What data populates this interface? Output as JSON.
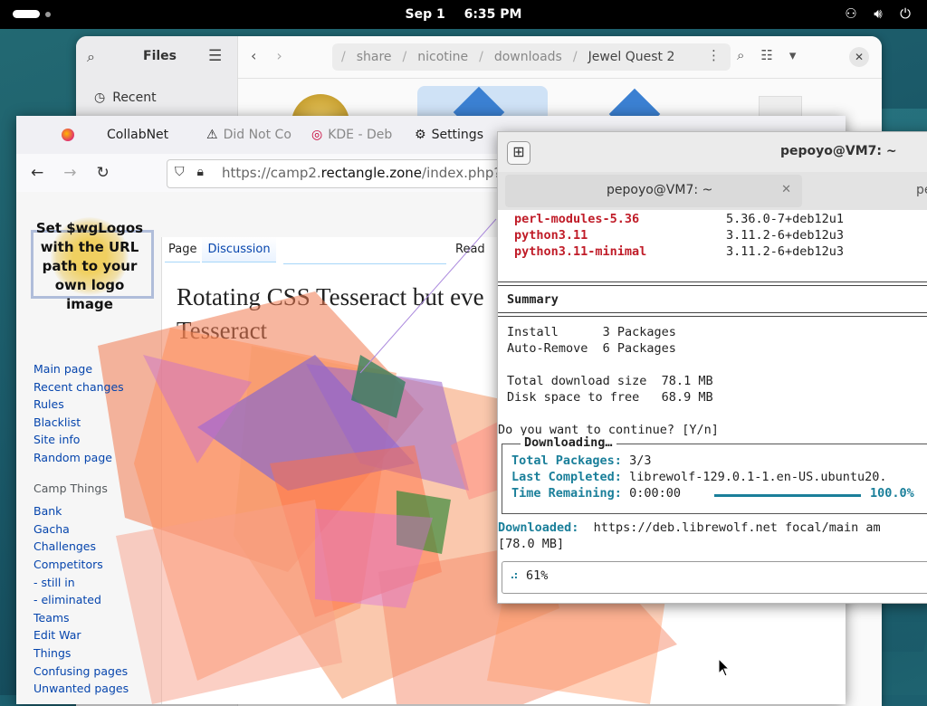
{
  "topbar": {
    "date": "Sep 1",
    "time": "6:35 PM",
    "tray_icons": [
      "network-icon",
      "volume-icon",
      "power-icon"
    ]
  },
  "files": {
    "title": "Files",
    "sidebar_recent": "Recent",
    "breadcrumbs": [
      "share",
      "nicotine",
      "downloads",
      "Jewel Quest 2"
    ]
  },
  "browser": {
    "tabs": [
      {
        "label": "CollabNet"
      },
      {
        "label": "Did Not Co"
      },
      {
        "label": "KDE - Deb"
      },
      {
        "label": "Settings"
      }
    ],
    "url_prefix": "https://camp2.",
    "url_domain": "rectangle.zone",
    "url_suffix": "/index.php?title",
    "logo_text": "Set $wgLogos with the URL path to your own logo image",
    "content_tabs": {
      "page": "Page",
      "discussion": "Discussion",
      "read": "Read"
    },
    "page_title": "Rotating CSS Tesseract but eve Tesseract",
    "nav_main": [
      "Main page",
      "Recent changes",
      "Rules",
      "Blacklist",
      "Site info",
      "Random page"
    ],
    "nav_section_title": "Camp Things",
    "nav_camp": [
      "Bank",
      "Gacha",
      "Challenges",
      "Competitors",
      "- still in",
      "- eliminated",
      "Teams",
      "Edit War",
      "Things",
      "Confusing pages",
      "Unwanted pages"
    ]
  },
  "terminal": {
    "title": "pepoyo@VM7: ~",
    "tab_label": "pepoyo@VM7: ~",
    "tab2_label": "pe",
    "packages": [
      {
        "name": "perl-modules-5.36",
        "version": "5.36.0-7+deb12u1"
      },
      {
        "name": "python3.11",
        "version": "3.11.2-6+deb12u3"
      },
      {
        "name": "python3.11-minimal",
        "version": "3.11.2-6+deb12u3"
      }
    ],
    "summary": "Summary",
    "install_line": "Install      3 Packages",
    "autoremove_line": "Auto-Remove  6 Packages",
    "download_size": "Total download size  78.1 MB",
    "disk_space": "Disk space to free   68.9 MB",
    "prompt": "Do you want to continue? [Y/n]",
    "dl_title": "Downloading…",
    "total_packages_label": "Total Packages:",
    "total_packages_value": "3/3",
    "last_completed_label": "Last Completed:",
    "last_completed_value": "librewolf-129.0.1-1.en-US.ubuntu20.",
    "time_remaining_label": "Time Remaining:",
    "time_remaining_value": "0:00:00",
    "download_percent": "100.0%",
    "downloaded_label": "Downloaded:",
    "downloaded_value": "https://deb.librewolf.net focal/main am",
    "downloaded_size": "[78.0 MB]",
    "overall_progress": "61%"
  }
}
